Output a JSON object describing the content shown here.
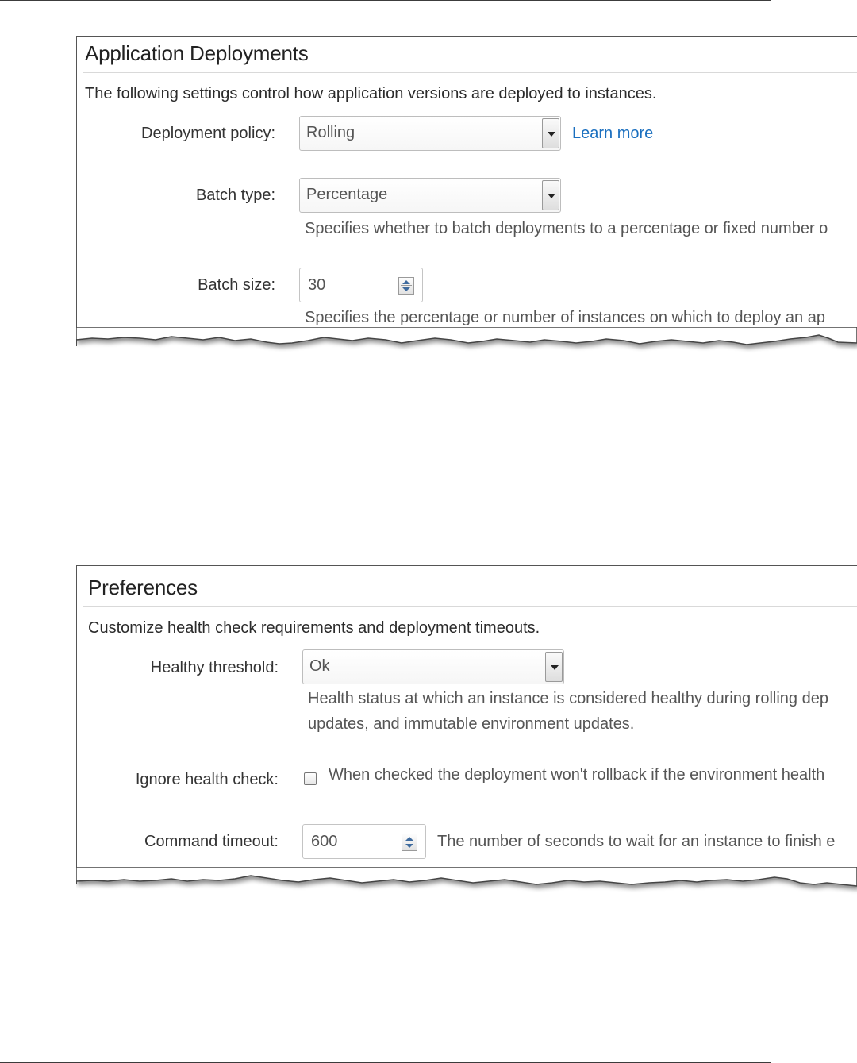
{
  "app_deployments": {
    "title": "Application Deployments",
    "description": "The following settings control how application versions are deployed to instances.",
    "deployment_policy": {
      "label": "Deployment policy:",
      "value": "Rolling",
      "learn_more": "Learn more"
    },
    "batch_type": {
      "label": "Batch type:",
      "value": "Percentage",
      "help": "Specifies whether to batch deployments to a percentage or fixed number o"
    },
    "batch_size": {
      "label": "Batch size:",
      "value": "30",
      "help": "Specifies the percentage or number of instances on which to deploy an ap"
    }
  },
  "preferences": {
    "title": "Preferences",
    "description": "Customize health check requirements and deployment timeouts.",
    "healthy_threshold": {
      "label": "Healthy threshold:",
      "value": "Ok",
      "help_line1": "Health status at which an instance is considered healthy during rolling dep",
      "help_line2": "updates, and immutable environment updates."
    },
    "ignore_health_check": {
      "label": "Ignore health check:",
      "checked": false,
      "help": "When checked the deployment won't rollback if the environment health"
    },
    "command_timeout": {
      "label": "Command timeout:",
      "value": "600",
      "help": "The number of seconds to wait for an instance to finish e"
    }
  },
  "colors": {
    "link": "#1a6fbf",
    "spinner_arrow": "#3f6b9e"
  }
}
